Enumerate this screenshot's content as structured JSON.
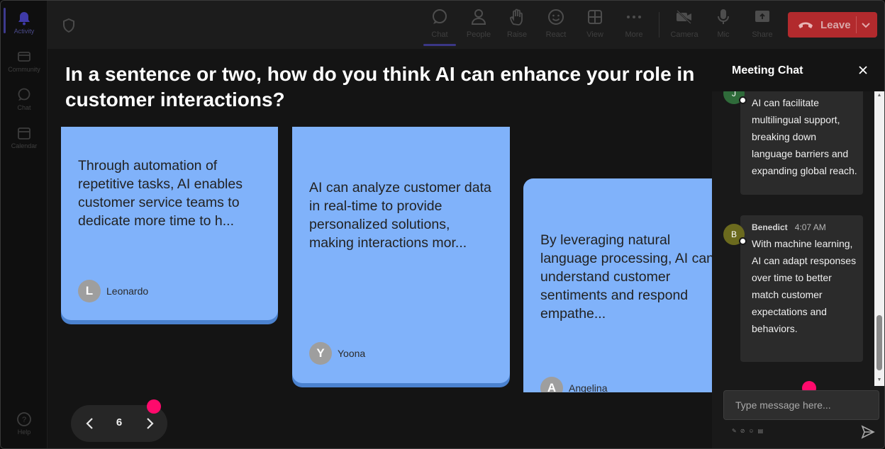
{
  "rail": {
    "items": [
      {
        "label": "Activity",
        "icon": "bell-icon"
      },
      {
        "label": "Community",
        "icon": "community-icon"
      },
      {
        "label": "Chat",
        "icon": "chat-icon"
      },
      {
        "label": "Calendar",
        "icon": "calendar-icon"
      }
    ],
    "help": {
      "label": "Help",
      "icon": "help-icon"
    }
  },
  "toolbar": {
    "chat": "Chat",
    "people": "People",
    "raise": "Raise",
    "react": "React",
    "view": "View",
    "more": "More",
    "camera": "Camera",
    "mic": "Mic",
    "share": "Share",
    "leave": "Leave"
  },
  "main": {
    "question": "In a sentence or two, how do you think AI can enhance your role in customer interactions?",
    "cards": [
      {
        "text": "Through automation of repetitive tasks, AI enables customer service teams to dedicate more time to h...",
        "initial": "L",
        "author": "Leonardo"
      },
      {
        "text": "AI can analyze customer data in real-time to provide personalized solutions, making interactions mor...",
        "initial": "Y",
        "author": "Yoona"
      },
      {
        "text": "By leveraging natural language processing, AI can understand customer sentiments and respond empathe...",
        "initial": "A",
        "author": "Angelina"
      }
    ],
    "pager": {
      "page": "6"
    }
  },
  "chat": {
    "title": "Meeting Chat",
    "messages": [
      {
        "initial": "J",
        "sender": "",
        "time": "",
        "text": "AI can facilitate multilingual support, breaking down language barriers and expanding global reach."
      },
      {
        "initial": "B",
        "sender": "Benedict",
        "time": "4:07 AM",
        "text": "With machine learning, AI can adapt responses over time to better match customer expectations and behaviors."
      }
    ],
    "input_placeholder": "Type message here..."
  },
  "colors": {
    "card": "#80b2fa",
    "card_shadow": "#4b82cf",
    "leave": "#b22a2d",
    "marker": "#ff0a6c",
    "avatar_j": "#2f6b3a",
    "avatar_b": "#6b6a1e"
  }
}
